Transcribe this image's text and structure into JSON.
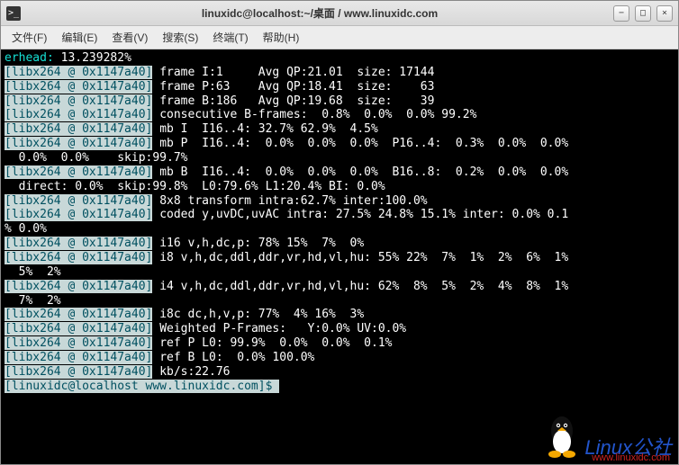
{
  "window": {
    "title": "linuxidc@localhost:~/桌面 / www.linuxidc.com"
  },
  "menu": {
    "file": "文件(F)",
    "edit": "编辑(E)",
    "view": "查看(V)",
    "search": "搜索(S)",
    "terminal": "终端(T)",
    "help": "帮助(H)"
  },
  "term": {
    "l0a": "erhead: ",
    "l0b": "13.239282%",
    "tag": "[libx264 @ 0x1147a40]",
    "l1": " frame I:1     Avg QP:21.01  size: 17144",
    "l2": " frame P:63    Avg QP:18.41  size:    63",
    "l3": " frame B:186   Avg QP:19.68  size:    39",
    "l4": " consecutive B-frames:  0.8%  0.0%  0.0% 99.2%",
    "l5": " mb I  I16..4: 32.7% 62.9%  4.5%",
    "l6": " mb P  I16..4:  0.0%  0.0%  0.0%  P16..4:  0.3%  0.0%  0.0%",
    "l6b": "  0.0%  0.0%    skip:99.7%",
    "l7": " mb B  I16..4:  0.0%  0.0%  0.0%  B16..8:  0.2%  0.0%  0.0%",
    "l7b": "  direct: 0.0%  skip:99.8%  L0:79.6% L1:20.4% BI: 0.0%",
    "l8": " 8x8 transform intra:62.7% inter:100.0%",
    "l9": " coded y,uvDC,uvAC intra: 27.5% 24.8% 15.1% inter: 0.0% 0.1",
    "l9b": "% 0.0%",
    "l10": " i16 v,h,dc,p: 78% 15%  7%  0%",
    "l11": " i8 v,h,dc,ddl,ddr,vr,hd,vl,hu: 55% 22%  7%  1%  2%  6%  1%",
    "l11b": "  5%  2%",
    "l12": " i4 v,h,dc,ddl,ddr,vr,hd,vl,hu: 62%  8%  5%  2%  4%  8%  1%",
    "l12b": "  7%  2%",
    "l13": " i8c dc,h,v,p: 77%  4% 16%  3%",
    "l14": " Weighted P-Frames:   Y:0.0% UV:0.0%",
    "l15": " ref P L0: 99.9%  0.0%  0.0%  0.1%",
    "l16": " ref B L0:  0.0% 100.0%",
    "l17": " kb/s:22.76",
    "prompt": "[linuxidc@localhost www.linuxidc.com]$ "
  },
  "logo": {
    "text": "Linux",
    "cn": "公社",
    "url": "www.linuxidc.com"
  }
}
